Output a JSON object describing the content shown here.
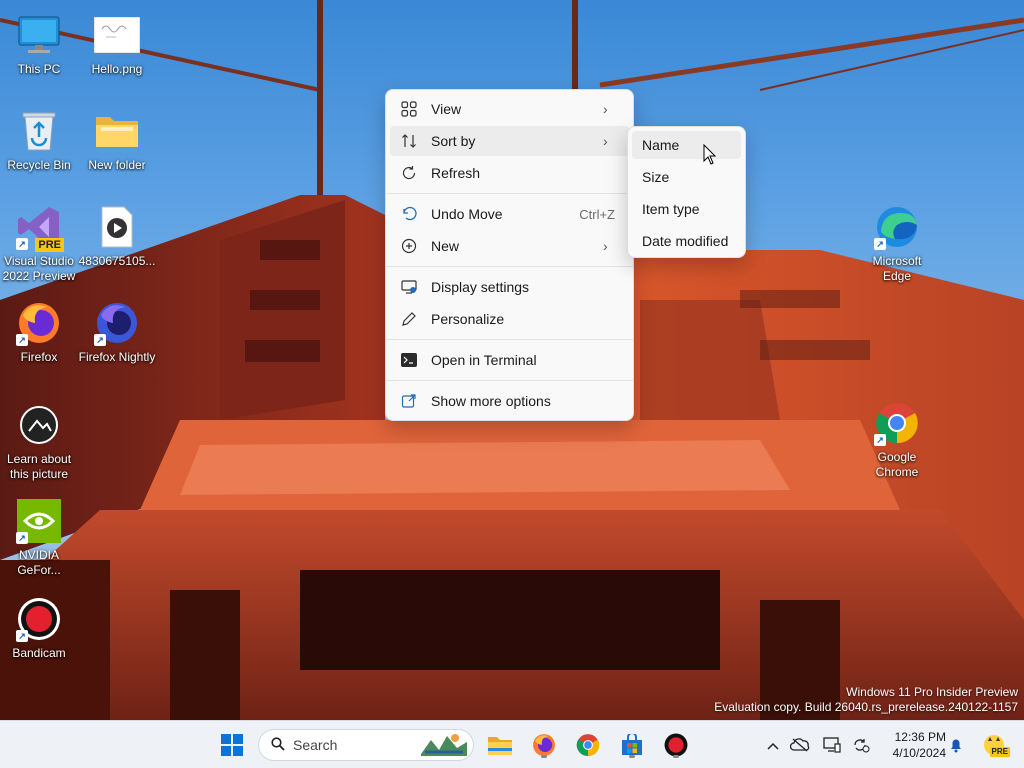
{
  "desktop": {
    "icons": [
      {
        "label": "This PC"
      },
      {
        "label": "Hello.png"
      },
      {
        "label": "Recycle Bin"
      },
      {
        "label": "New folder"
      },
      {
        "label": "Visual Studio 2022 Preview"
      },
      {
        "label": "4830675105..."
      },
      {
        "label": "Firefox"
      },
      {
        "label": "Firefox Nightly"
      },
      {
        "label": "Learn about this picture"
      },
      {
        "label": "NVIDIA GeFor..."
      },
      {
        "label": "Bandicam"
      },
      {
        "label": "Microsoft Edge"
      },
      {
        "label": "Google Chrome"
      }
    ],
    "vs_badge": "PRE"
  },
  "watermark": {
    "line1": "Windows 11 Pro Insider Preview",
    "line2": "Evaluation copy. Build 26040.rs_prerelease.240122-1157"
  },
  "context_menu": {
    "items": [
      {
        "label": "View",
        "icon": "grid-view-icon",
        "submenu": true
      },
      {
        "label": "Sort by",
        "icon": "sort-arrows-icon",
        "submenu": true,
        "highlighted": true
      },
      {
        "label": "Refresh",
        "icon": "refresh-icon"
      },
      {
        "label": "Undo Move",
        "icon": "undo-icon",
        "shortcut": "Ctrl+Z"
      },
      {
        "label": "New",
        "icon": "plus-circle-icon",
        "submenu": true
      },
      {
        "label": "Display settings",
        "icon": "display-settings-icon"
      },
      {
        "label": "Personalize",
        "icon": "pen-icon"
      },
      {
        "label": "Open in Terminal",
        "icon": "terminal-icon"
      },
      {
        "label": "Show more options",
        "icon": "share-external-icon"
      }
    ]
  },
  "sort_submenu": {
    "items": [
      {
        "label": "Name",
        "highlighted": true
      },
      {
        "label": "Size"
      },
      {
        "label": "Item type"
      },
      {
        "label": "Date modified"
      }
    ]
  },
  "taskbar": {
    "search_placeholder": "Search",
    "pinned": [
      "windows-start-icon",
      "file-explorer-icon",
      "firefox-icon",
      "chrome-icon",
      "microsoft-store-icon",
      "bandicam-icon"
    ],
    "tray_icons": [
      "chevron-up-icon",
      "onedrive-icon",
      "display-icon",
      "sync-icon"
    ],
    "time": "12:36 PM",
    "date": "4/10/2024",
    "pre_badge": "PRE"
  },
  "colors": {
    "accent": "#0067c0",
    "menu_bg": "#f9f9f9",
    "taskbar_bg": "#eef1f6",
    "bridge_red": "#c2402a"
  }
}
